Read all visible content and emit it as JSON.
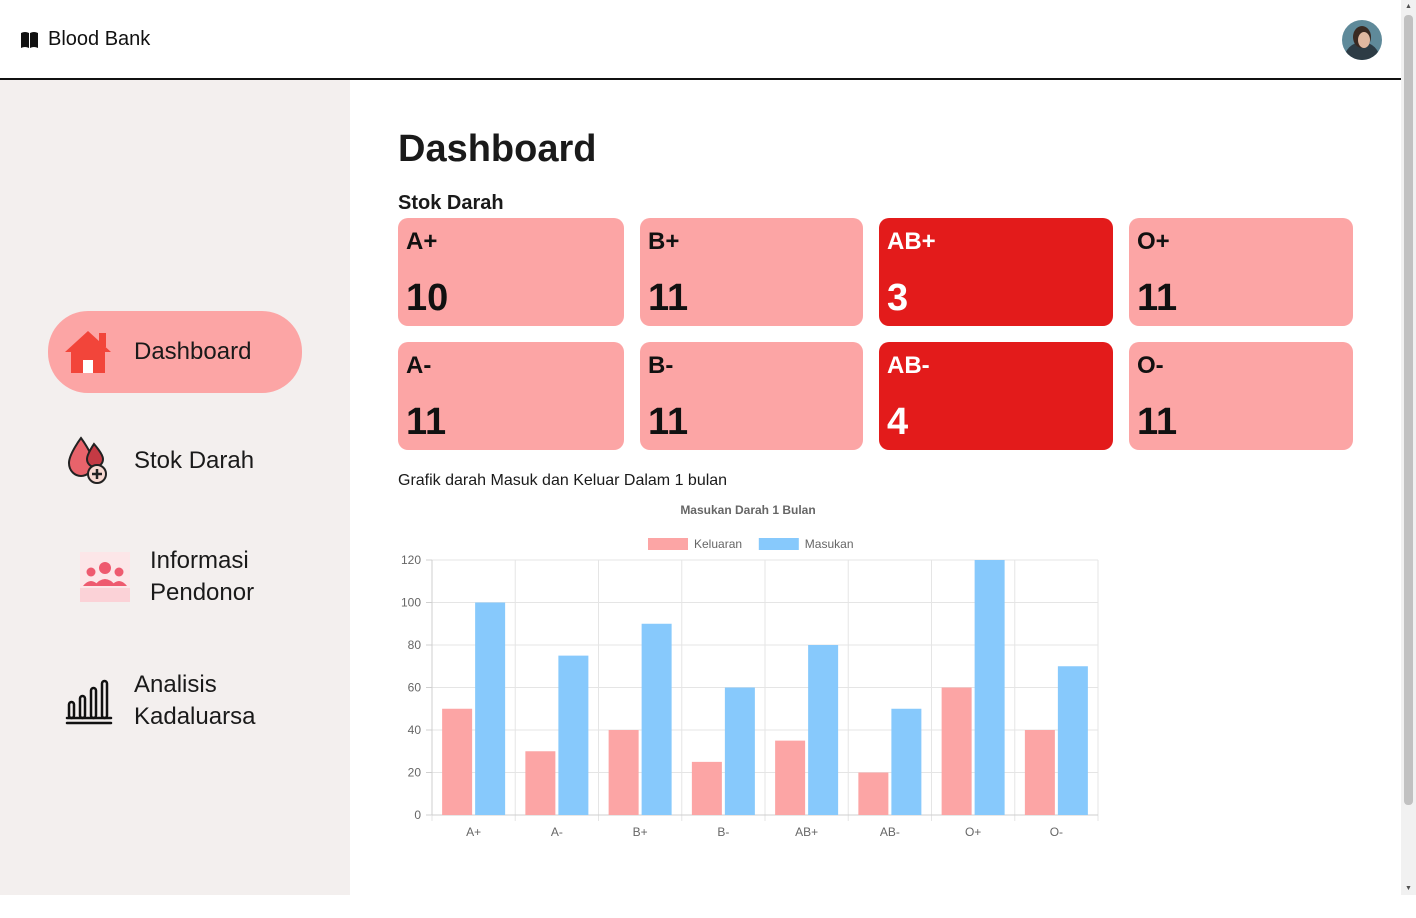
{
  "app": {
    "title": "Blood Bank"
  },
  "sidebar": {
    "items": [
      {
        "label": "Dashboard",
        "icon": "house-icon",
        "active": true
      },
      {
        "label": "Stok Darah",
        "icon": "blood-drop-icon"
      },
      {
        "label": "Informasi Pendonor",
        "icon": "donor-group-icon"
      },
      {
        "label": "Analisis Kadaluarsa",
        "icon": "bar-chart-icon"
      }
    ]
  },
  "main": {
    "title": "Dashboard",
    "stock_title": "Stok Darah",
    "stock": [
      {
        "type": "A+",
        "count": "10",
        "low": false
      },
      {
        "type": "B+",
        "count": "11",
        "low": false
      },
      {
        "type": "AB+",
        "count": "3",
        "low": true
      },
      {
        "type": "O+",
        "count": "11",
        "low": false
      },
      {
        "type": "A-",
        "count": "11",
        "low": false
      },
      {
        "type": "B-",
        "count": "11",
        "low": false
      },
      {
        "type": "AB-",
        "count": "4",
        "low": true
      },
      {
        "type": "O-",
        "count": "11",
        "low": false
      }
    ],
    "chart_caption": "Grafik darah Masuk dan Keluar Dalam 1 bulan"
  },
  "colors": {
    "card": "#fca5a5",
    "card_low": "#e31b1b",
    "keluaran": "#fca5a5",
    "masukan": "#87c9fc",
    "sidebar": "#f3efee"
  },
  "chart_data": {
    "type": "bar",
    "title": "Masukan Darah 1 Bulan",
    "categories": [
      "A+",
      "A-",
      "B+",
      "B-",
      "AB+",
      "AB-",
      "O+",
      "O-"
    ],
    "series": [
      {
        "name": "Keluaran",
        "color": "#fca5a5",
        "values": [
          50,
          30,
          40,
          25,
          35,
          20,
          60,
          40
        ]
      },
      {
        "name": "Masukan",
        "color": "#87c9fc",
        "values": [
          100,
          75,
          90,
          60,
          80,
          50,
          120,
          70
        ]
      }
    ],
    "yticks": [
      "0",
      "20",
      "40",
      "60",
      "80",
      "100",
      "120"
    ],
    "ylim": [
      0,
      120
    ],
    "grid": true,
    "legend": "top"
  }
}
